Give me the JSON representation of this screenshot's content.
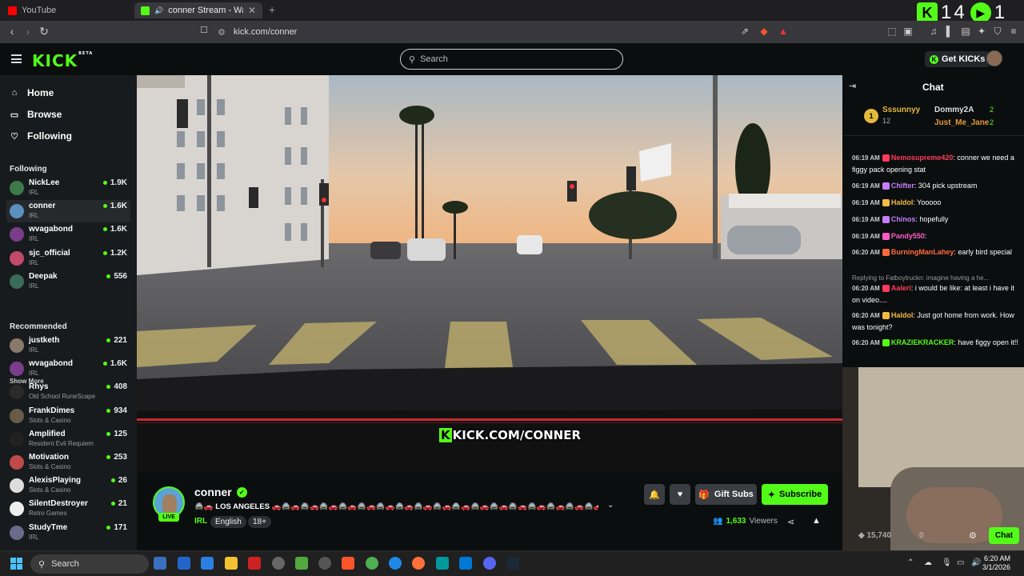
{
  "browser": {
    "tabs": [
      {
        "label": "YouTube"
      },
      {
        "label": "conner Stream - Watch Live o"
      }
    ],
    "url": "kick.com/conner",
    "overlay_counter": "14",
    "overlay_counter_right": "1"
  },
  "header": {
    "logo": "KICK",
    "logo_beta": "BETA",
    "search_placeholder": "Search",
    "get_kicks": "Get KICKs"
  },
  "sidebar": {
    "nav": [
      {
        "label": "Home",
        "icon": "home-icon"
      },
      {
        "label": "Browse",
        "icon": "browse-icon"
      },
      {
        "label": "Following",
        "icon": "heart-icon"
      }
    ],
    "following_heading": "Following",
    "following": [
      {
        "name": "NickLee",
        "category": "IRL",
        "viewers": "1.9K",
        "color": "#3f7a4a"
      },
      {
        "name": "conner",
        "category": "IRL",
        "viewers": "1.6K",
        "color": "#5a8fc0"
      },
      {
        "name": "wvagabond",
        "category": "IRL",
        "viewers": "1.6K",
        "color": "#7a3d8a"
      },
      {
        "name": "sjc_official",
        "category": "IRL",
        "viewers": "1.2K",
        "color": "#c24a6a"
      },
      {
        "name": "Deepak",
        "category": "IRL",
        "viewers": "556",
        "color": "#3a6a5a"
      }
    ],
    "show_more": "Show More",
    "recommended_heading": "Recommended",
    "recommended": [
      {
        "name": "justketh",
        "category": "IRL",
        "viewers": "221",
        "color": "#8a7a6a"
      },
      {
        "name": "wvagabond",
        "category": "IRL",
        "viewers": "1.6K",
        "color": "#7a3d8a"
      },
      {
        "name": "Rhys",
        "category": "Old School RuneScape",
        "viewers": "408",
        "color": "#2a2a2a"
      },
      {
        "name": "FrankDimes",
        "category": "Slots & Casino",
        "viewers": "934",
        "color": "#6a5a4a"
      },
      {
        "name": "Amplified",
        "category": "Resident Evil Requiem",
        "viewers": "125",
        "color": "#222"
      },
      {
        "name": "Motivation",
        "category": "Slots & Casino",
        "viewers": "253",
        "color": "#c04a4a"
      },
      {
        "name": "AlexisPlaying",
        "category": "Slots & Casino",
        "viewers": "26",
        "color": "#ddd"
      },
      {
        "name": "SilentDestroyer",
        "category": "Retro Games",
        "viewers": "21",
        "color": "#eee"
      },
      {
        "name": "StudyTme",
        "category": "IRL",
        "viewers": "171",
        "color": "#6a6a8a"
      }
    ]
  },
  "video": {
    "watermark": "KICK.COM/CONNER"
  },
  "stream": {
    "name": "conner",
    "live": "LIVE",
    "title": "🚔🚗 LOS ANGELES 🚗🚔🚗🚔🚗🚔🚗🚔🚗🚔🚗🚔🚗🚔🚗🚔🚗🚔🚗🚔🚗🚔🚗🚔🚗🚔🚗🚔🚗🚔🚗🚔🚗🚔🚗🚔🚗🚔🚗🚔🚗🚔...",
    "category": "IRL",
    "tags": [
      "English",
      "18+"
    ],
    "gift_subs": "Gift Subs",
    "subscribe": "Subscribe",
    "viewers_count": "1,633",
    "viewers_label": "Viewers"
  },
  "chat": {
    "title": "Chat",
    "leaderboard": {
      "first_rank": "1",
      "first_name": "Sssunnyy",
      "first_count": "12",
      "second_name": "Dommy2A",
      "second_count": "2",
      "third_name": "Just_Me_Jane",
      "third_count": "2"
    },
    "messages": [
      {
        "time": "06:19 AM",
        "user": "Nemosupreme420",
        "color": "#ff3b5c",
        "text": ": conner we need a figgy pack opening stat"
      },
      {
        "time": "06:19 AM",
        "user": "Chifter",
        "color": "#c77dff",
        "text": ": 304 pick upstream"
      },
      {
        "time": "06:19 AM",
        "user": "Haldol",
        "color": "#f4b942",
        "text": ": Yooooo"
      },
      {
        "time": "06:19 AM",
        "user": "Chinos",
        "color": "#c77dff",
        "text": ": hopefully"
      },
      {
        "time": "06:19 AM",
        "user": "Pandy550",
        "color": "#ff5cc8",
        "text": ":"
      },
      {
        "time": "06:20 AM",
        "user": "BurningManLahey",
        "color": "#ff6b3d",
        "text": ": early bird special"
      },
      {
        "time": "06:20 AM",
        "user": "Aaleri",
        "color": "#ff3b5c",
        "text": ": i would be like: at least i have it on video...."
      },
      {
        "time": "06:20 AM",
        "user": "Haldol",
        "color": "#f4b942",
        "text": ": Just got home from work. How was tonight?"
      },
      {
        "time": "06:20 AM",
        "user": "KRAZIEKRACKER",
        "color": "#53fc18",
        "text": ": have figgy open it!!"
      }
    ],
    "reply_note": "Replying to Fatboytruckn: imagine having a he...",
    "kicks_balance": "15,740",
    "kicks_secondary": "0",
    "chat_button": "Chat"
  },
  "taskbar": {
    "search": "Search",
    "time": "6:20 AM",
    "date": "3/1/2026"
  }
}
